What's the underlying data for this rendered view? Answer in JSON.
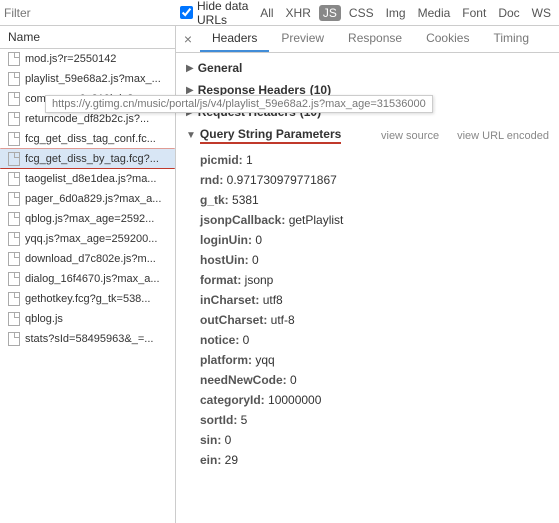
{
  "topbar": {
    "filter_placeholder": "Filter",
    "hide_label": "Hide data URLs",
    "tags": [
      "All",
      "XHR",
      "JS",
      "CSS",
      "Img",
      "Media",
      "Font",
      "Doc",
      "WS"
    ],
    "active_tag": "JS"
  },
  "left": {
    "header": "Name",
    "items": [
      "mod.js?r=2550142",
      "playlist_59e68a2.js?max_...",
      "common_e6a819b.js?ma...",
      "returncode_df82b2c.js?...",
      "fcg_get_diss_tag_conf.fc...",
      "fcg_get_diss_by_tag.fcg?...",
      "taogelist_d8e1dea.js?ma...",
      "pager_6d0a829.js?max_a...",
      "qblog.js?max_age=2592...",
      "yqq.js?max_age=259200...",
      "download_d7c802e.js?m...",
      "dialog_16f4670.js?max_a...",
      "gethotkey.fcg?g_tk=538...",
      "qblog.js",
      "stats?sId=58495963&_=..."
    ],
    "selected_index": 5
  },
  "tabs": {
    "items": [
      "Headers",
      "Preview",
      "Response",
      "Cookies",
      "Timing"
    ],
    "active": "Headers"
  },
  "sections": {
    "general": "General",
    "response_headers": {
      "title": "Response Headers",
      "count": "(10)"
    },
    "request_headers": {
      "title": "Request Headers",
      "count": "(10)"
    },
    "qsp": {
      "title": "Query String Parameters",
      "view_source": "view source",
      "view_url": "view URL encoded"
    }
  },
  "tooltip": "https://y.gtimg.cn/music/portal/js/v4/playlist_59e68a2.js?max_age=31536000",
  "params": [
    {
      "k": "picmid",
      "v": "1"
    },
    {
      "k": "rnd",
      "v": "0.971730979771867"
    },
    {
      "k": "g_tk",
      "v": "5381"
    },
    {
      "k": "jsonpCallback",
      "v": "getPlaylist"
    },
    {
      "k": "loginUin",
      "v": "0"
    },
    {
      "k": "hostUin",
      "v": "0"
    },
    {
      "k": "format",
      "v": "jsonp"
    },
    {
      "k": "inCharset",
      "v": "utf8"
    },
    {
      "k": "outCharset",
      "v": "utf-8"
    },
    {
      "k": "notice",
      "v": "0"
    },
    {
      "k": "platform",
      "v": "yqq"
    },
    {
      "k": "needNewCode",
      "v": "0"
    },
    {
      "k": "categoryId",
      "v": "10000000"
    },
    {
      "k": "sortId",
      "v": "5"
    },
    {
      "k": "sin",
      "v": "0"
    },
    {
      "k": "ein",
      "v": "29"
    }
  ]
}
